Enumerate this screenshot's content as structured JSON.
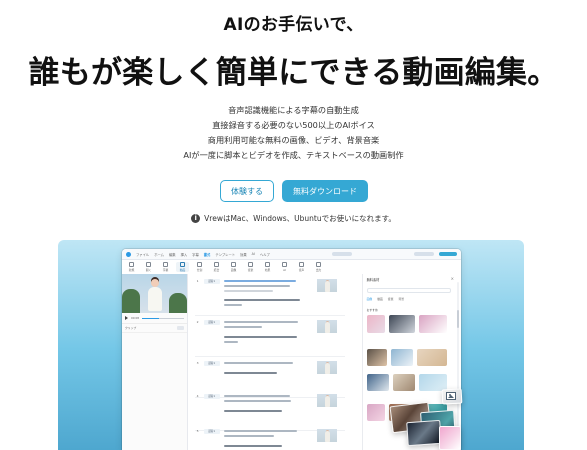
{
  "hero": {
    "subtitle": "AIのお手伝いで、",
    "title": "誰もが楽しく簡単にできる動画編集。",
    "features": [
      "音声認識機能による字幕の自動生成",
      "直接録音する必要のない500以上のAIボイス",
      "商用利用可能な無料の画像、ビデオ、背景音楽",
      "AIが一度に脚本とビデオを作成、テキストベースの動画制作"
    ],
    "buttons": {
      "trial": "体験する",
      "download": "無料ダウンロード"
    },
    "note": "VrewはMac、Windows、Ubuntuでお使いになれます。"
  },
  "colors": {
    "accent": "#35a8d4",
    "showcase_top": "#bfe6f5",
    "showcase_bottom": "#4ea7cf"
  }
}
